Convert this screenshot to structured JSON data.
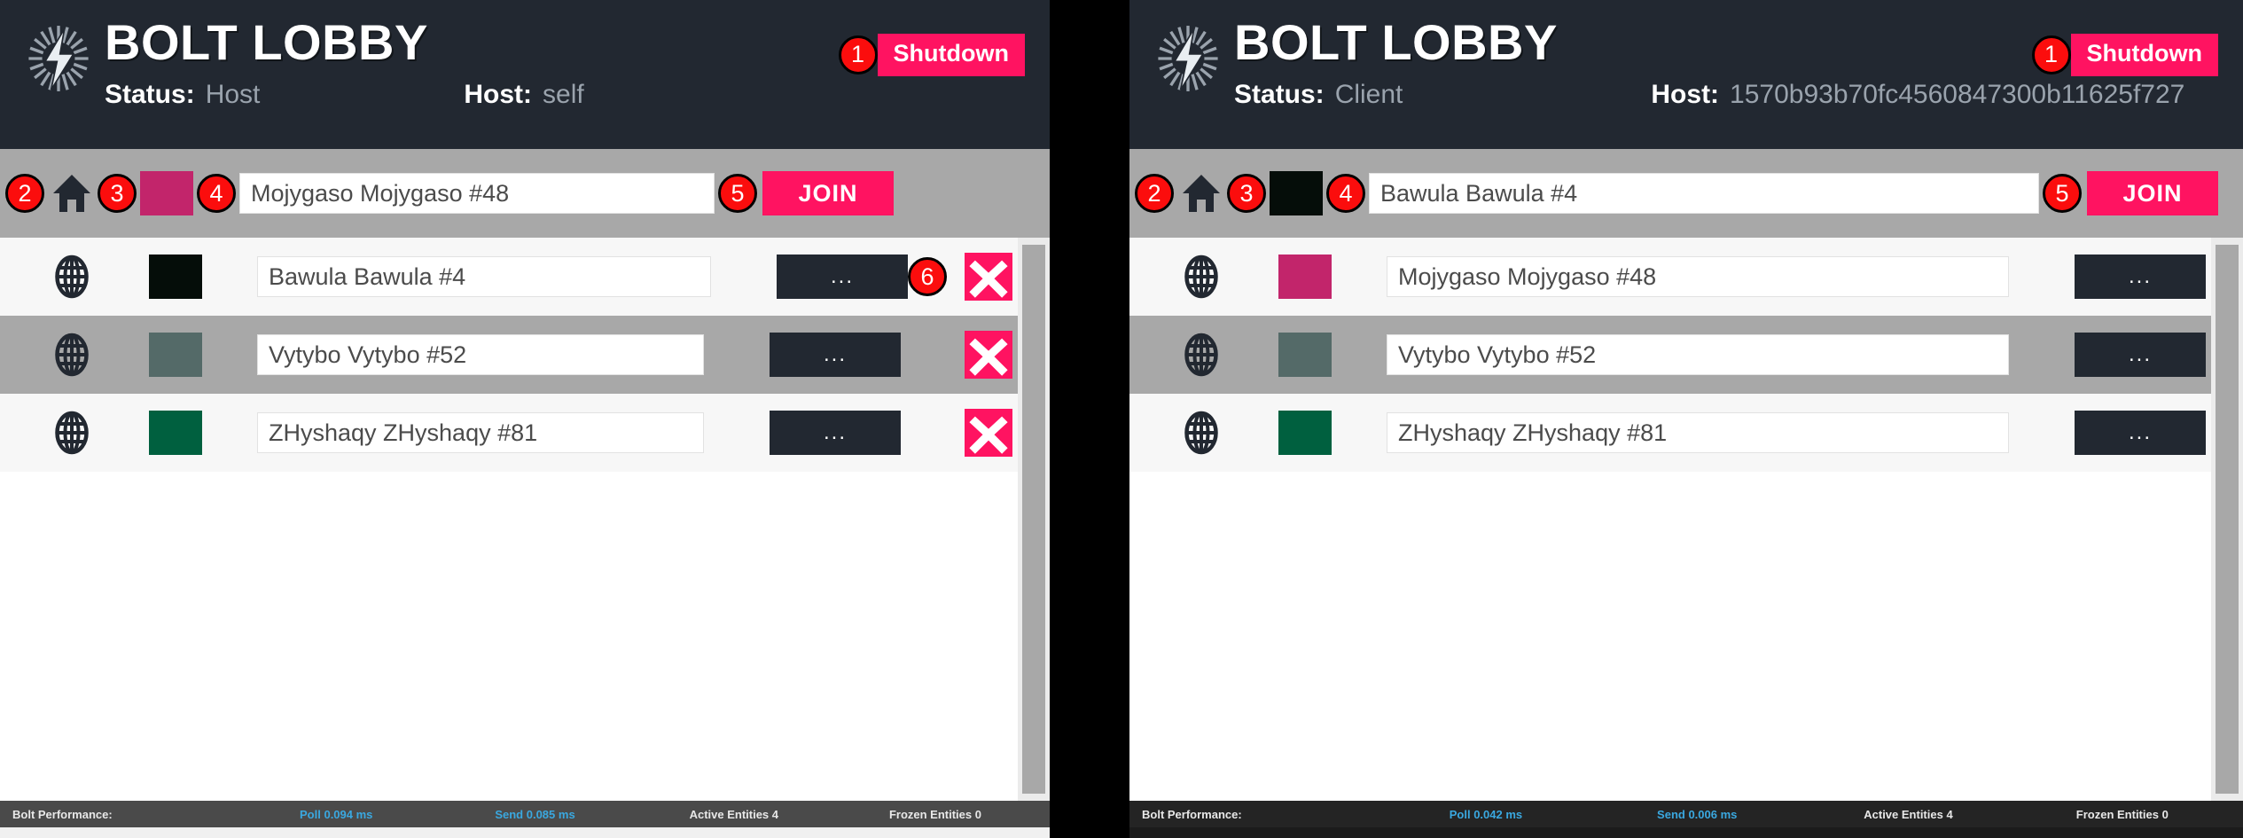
{
  "panels": [
    {
      "id": "host-panel",
      "header": {
        "title": "BOLT LOBBY",
        "status_label": "Status:",
        "status_value": "Host",
        "host_label": "Host:",
        "host_value": "self",
        "shutdown_label": "Shutdown",
        "shutdown_badge": "1"
      },
      "toolbar": {
        "home_badge": "2",
        "swatch_badge": "3",
        "swatch_color": "#c2256b",
        "name_badge": "4",
        "name_value": "Mojygaso Mojygaso #48",
        "join_badge": "5",
        "join_label": "JOIN"
      },
      "rows": [
        {
          "swatch_color": "#050d09",
          "name_value": "Bawula Bawula #4",
          "more_label": "...",
          "close_badge": "6",
          "has_close": true,
          "highlighted": false
        },
        {
          "swatch_color": "#546a68",
          "name_value": "Vytybo Vytybo #52",
          "more_label": "...",
          "close_badge": "",
          "has_close": true,
          "highlighted": true
        },
        {
          "swatch_color": "#00603f",
          "name_value": "ZHyshaqy ZHyshaqy #81",
          "more_label": "...",
          "close_badge": "",
          "has_close": true,
          "highlighted": false
        }
      ],
      "statusbar": {
        "label": "Bolt Performance:",
        "poll": "Poll 0.094 ms",
        "send": "Send 0.085 ms",
        "active_entities": "Active Entities 4",
        "frozen_entities": "Frozen Entities 0"
      }
    },
    {
      "id": "client-panel",
      "header": {
        "title": "BOLT LOBBY",
        "status_label": "Status:",
        "status_value": "Client",
        "host_label": "Host:",
        "host_value": "1570b93b70fc4560847300b11625f727",
        "shutdown_label": "Shutdown",
        "shutdown_badge": "1"
      },
      "toolbar": {
        "home_badge": "2",
        "swatch_badge": "3",
        "swatch_color": "#050d09",
        "name_badge": "4",
        "name_value": "Bawula Bawula #4",
        "join_badge": "5",
        "join_label": "JOIN"
      },
      "rows": [
        {
          "swatch_color": "#c2256b",
          "name_value": "Mojygaso Mojygaso #48",
          "more_label": "...",
          "close_badge": "",
          "has_close": false,
          "highlighted": false
        },
        {
          "swatch_color": "#546a68",
          "name_value": "Vytybo Vytybo #52",
          "more_label": "...",
          "close_badge": "",
          "has_close": false,
          "highlighted": true
        },
        {
          "swatch_color": "#00603f",
          "name_value": "ZHyshaqy ZHyshaqy #81",
          "more_label": "...",
          "close_badge": "",
          "has_close": false,
          "highlighted": false
        }
      ],
      "statusbar": {
        "label": "Bolt Performance:",
        "poll": "Poll 0.042 ms",
        "send": "Send 0.006 ms",
        "active_entities": "Active Entities 4",
        "frozen_entities": "Frozen Entities 0"
      }
    }
  ],
  "colors": {
    "accent_pink": "#ff1361",
    "badge_red": "#fb0d0d",
    "header_dark": "#222831",
    "toolbar_gray": "#a8a8a8"
  },
  "icons": {
    "logo": "bolt-logo-icon",
    "home": "home-icon",
    "globe": "globe-icon",
    "close": "close-x-icon"
  }
}
